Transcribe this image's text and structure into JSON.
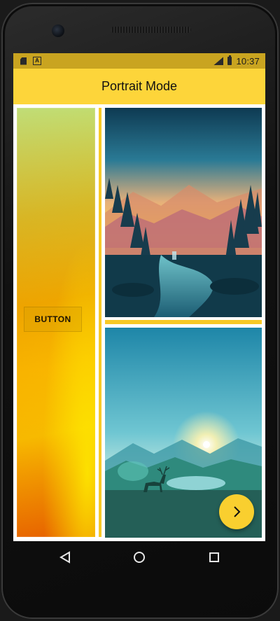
{
  "status_bar": {
    "time": "10:37",
    "icons": [
      "sim-card-icon",
      "a-notification-icon",
      "lte-signal-icon",
      "battery-charging-icon"
    ]
  },
  "app_bar": {
    "title": "Portrait Mode"
  },
  "left_panel": {
    "button_label": "BUTTON"
  },
  "images": [
    "forest-lake-sunset-illustration",
    "deer-mountain-lake-illustration"
  ],
  "fab": {
    "icon": "chevron-right-icon"
  },
  "nav_bar": {
    "icons": [
      "back-icon",
      "home-icon",
      "recents-icon"
    ]
  },
  "colors": {
    "accent": "#fdd53a",
    "status_bar": "#c9a420",
    "fab": "#f9cf2f"
  }
}
